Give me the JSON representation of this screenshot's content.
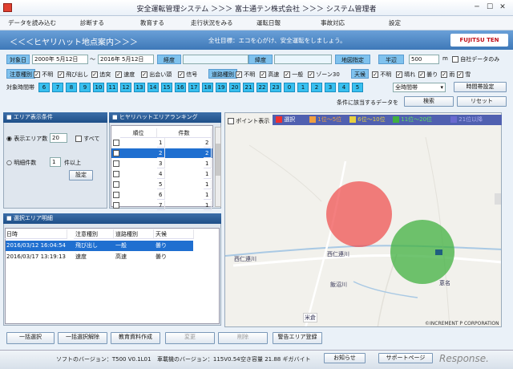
{
  "window": {
    "title": "安全運転管理システム ＞＞＞ 富士通テン株式会社 ＞＞＞ システム管理者",
    "min": "─",
    "max": "☐",
    "close": "✕"
  },
  "menu": [
    "データを読み込む",
    "診断する",
    "教育する",
    "走行状況をみる",
    "運転日報",
    "事故対応",
    "設定"
  ],
  "header": {
    "title": "＜＜＜ヒヤリハット地点案内＞＞＞",
    "goal": "全社目標：エコを心がけ、安全運転をしましょう。",
    "logo": "FUJITSU TEN"
  },
  "filter": {
    "date_label": "対象日",
    "date_from": "2000年 5月12日",
    "tilde": "～",
    "date_to": "2016年 5月12日",
    "lat_label": "経度",
    "lon_label": "緯度",
    "map_btn": "地図指定",
    "radius_label": "半辺",
    "radius_value": "500",
    "radius_unit": "m",
    "own_data": "自社データのみ",
    "attention_label": "注意種別",
    "attention": [
      "不明",
      "飛び出し",
      "追突",
      "速度",
      "出会い頭",
      "信号"
    ],
    "road_label": "道路種別",
    "road": [
      "不明",
      "高速",
      "一般",
      "ゾーン30"
    ],
    "weather_label": "天候",
    "weather": [
      "不明",
      "晴れ",
      "曇り",
      "雨",
      "雪"
    ],
    "hours_label": "対象時間帯",
    "hours": [
      "6",
      "7",
      "8",
      "9",
      "10",
      "11",
      "12",
      "13",
      "14",
      "15",
      "16",
      "17",
      "18",
      "19",
      "20",
      "21",
      "22",
      "23",
      "0",
      "1",
      "2",
      "3",
      "4",
      "5"
    ],
    "time_select": "全時間帯",
    "time_btn": "時間帯設定",
    "cond_text": "条件に該当するデータを",
    "search": "検索",
    "reset": "リセット"
  },
  "area": {
    "title": "エリア表示条件",
    "radio1": "表示エリア数",
    "count": "20",
    "all": "すべて",
    "radio2": "明細件数",
    "min": "1",
    "min_unit": "件以上",
    "set": "設定"
  },
  "ranking": {
    "title": "ヒヤリハットエリアランキング",
    "cols": [
      "順位",
      "件数"
    ],
    "rows": [
      [
        "1",
        "2"
      ],
      [
        "2",
        "2"
      ],
      [
        "3",
        "1"
      ],
      [
        "4",
        "1"
      ],
      [
        "5",
        "1"
      ],
      [
        "6",
        "1"
      ],
      [
        "7",
        "1"
      ]
    ]
  },
  "detail": {
    "title": "選択エリア明細",
    "cols": [
      "日時",
      "注意種別",
      "道路種別",
      "天候"
    ],
    "rows": [
      [
        "2016/03/12 16:04:54",
        "飛び出し",
        "一般",
        "曇り"
      ],
      [
        "2016/03/17 13:19:13",
        "速度",
        "高速",
        "曇り"
      ]
    ]
  },
  "map": {
    "point_label": "ポイント表示",
    "legend": [
      "選択",
      "1位～5位",
      "6位～10位",
      "11位～20位",
      "21位以降"
    ],
    "legend_colors": [
      "#f03030",
      "#f0a040",
      "#e8d040",
      "#40b040",
      "#6a6ad0"
    ],
    "labels": [
      "西仁連川",
      "西仁連川",
      "飯沼川",
      "米倉",
      "恵名"
    ],
    "copyright": "©INCREMENT P CORPORATION"
  },
  "bottom": [
    "一括選択",
    "一括選択解除",
    "教育資料作成",
    "変更",
    "削除",
    "警告エリア登録"
  ],
  "status": {
    "soft": "ソフトのバージョン：T500 V0.1L01",
    "car": "車載機のバージョン：115V0.54",
    "space": "空き容量 21.88 ギガバイト",
    "notice": "お知らせ",
    "support": "サポートページ",
    "watermark": "Response."
  }
}
